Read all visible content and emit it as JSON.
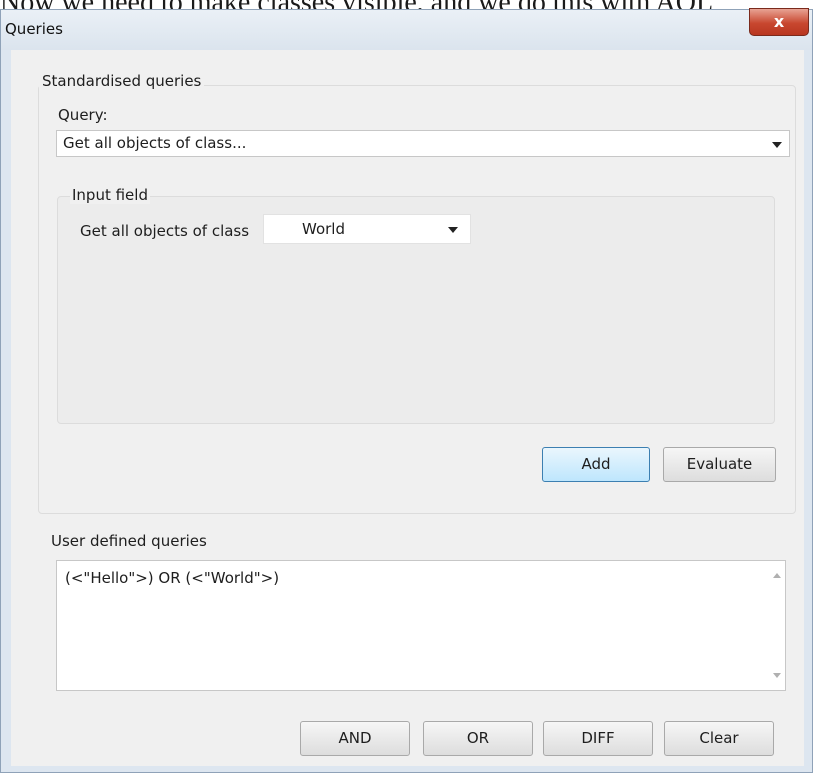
{
  "background_caption": "Now we need to make classes visible, and we do this with AQL",
  "window": {
    "title": "Queries",
    "close_label": "x"
  },
  "standardised": {
    "group_label": "Standardised queries",
    "query_label": "Query:",
    "query_value": "Get all objects of class...",
    "input_group_label": "Input field",
    "class_label": "Get all objects of class",
    "class_value": "World",
    "add_label": "Add",
    "evaluate_label": "Evaluate"
  },
  "user_defined": {
    "group_label": "User defined queries",
    "text": "(<\"Hello\">)  OR (<\"World\">)",
    "buttons": {
      "and": "AND",
      "or": "OR",
      "diff": "DIFF",
      "clear": "Clear"
    }
  },
  "colors": {
    "title_bar": "#dbe4ee",
    "close_button": "#c8472f",
    "add_button": "#bee6fd"
  }
}
